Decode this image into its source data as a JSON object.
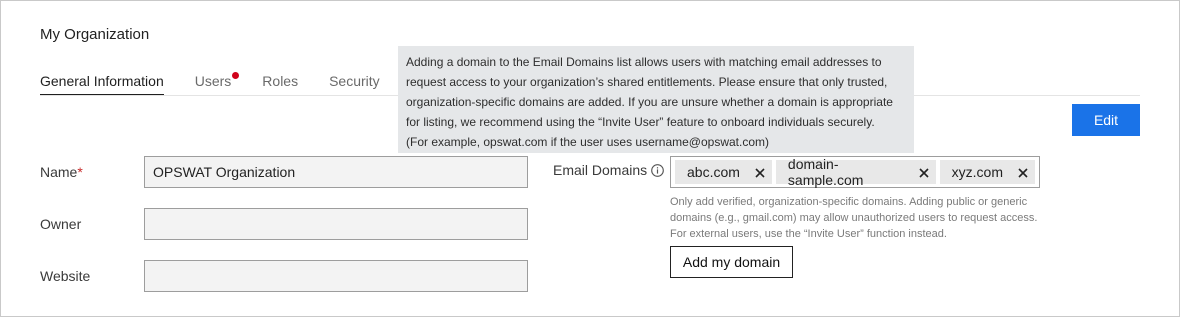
{
  "page": {
    "title": "My Organization"
  },
  "tabs": [
    {
      "label": "General Information",
      "active": true
    },
    {
      "label": "Users",
      "notification": true
    },
    {
      "label": "Roles"
    },
    {
      "label": "Security"
    }
  ],
  "tooltip": {
    "lines": [
      "Adding a domain to the Email Domains list allows users with matching email addresses to",
      "request access to your organization’s shared entitlements. Please ensure that only trusted,",
      "organization-specific domains are added. If you are unsure whether a domain is appropriate",
      "for listing, we recommend using the “Invite User” feature to onboard individuals securely.",
      "(For example, opswat.com if the user uses username@opswat.com)"
    ]
  },
  "edit_button": {
    "label": "Edit"
  },
  "form": {
    "name": {
      "label": "Name",
      "required_mark": "*",
      "value": "OPSWAT Organization"
    },
    "owner": {
      "label": "Owner",
      "value": ""
    },
    "website": {
      "label": "Website",
      "value": ""
    }
  },
  "email_domains": {
    "label": "Email Domains",
    "tags": [
      "abc.com",
      "domain-sample.com",
      "xyz.com"
    ],
    "hint_lines": [
      "Only add verified, organization-specific domains. Adding public or generic",
      "domains (e.g., gmail.com) may allow unauthorized users to request access.",
      "For external users, use the “Invite User” function instead."
    ],
    "add_button_label": "Add my domain"
  },
  "colors": {
    "primary": "#1a73e8",
    "notification": "#d0021b",
    "tooltip_bg": "#e5e7e9",
    "required": "#c62828"
  }
}
